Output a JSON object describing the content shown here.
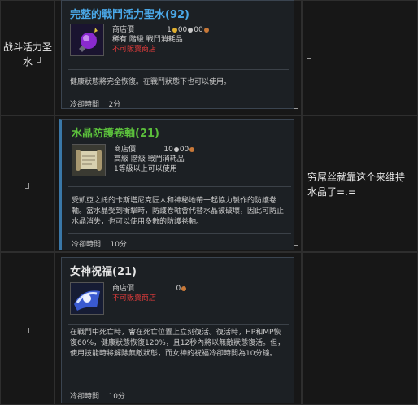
{
  "rows": [
    {
      "left": "战斗活力圣水",
      "right": "",
      "item": {
        "name": "完整的戰鬥活力聖水",
        "count": "(92)",
        "price_label": "商店價",
        "price_parts": [
          "1",
          "00",
          "00"
        ],
        "grade": "稀有 階級 戰鬥消耗品",
        "restriction": "不可販賣商店",
        "level_req": "",
        "description": "健康狀態將完全恢復。在戰鬥狀態下也可以使用。",
        "cooldown_label": "冷卻時間",
        "cooldown": "2分"
      }
    },
    {
      "left": "",
      "right": "穷屌丝就靠这个来维持水晶了=.=",
      "item": {
        "name": "水晶防護卷軸",
        "count": "(21)",
        "price_label": "商店價",
        "price_parts": [
          "10",
          "00",
          ""
        ],
        "grade": "高級 階級 戰鬥消耗品",
        "restriction": "",
        "level_req": "1等級以上可以使用",
        "description": "受凱亞之託的卡斯塔尼克匠人和神秘地帶一起協力製作的防護卷軸。當水晶受到衝擊時，防護卷軸會代替水晶被破壞，因此可防止水晶消失，也可以使用多數的防護卷軸。",
        "cooldown_label": "冷卻時間",
        "cooldown": "10分"
      }
    },
    {
      "left": "",
      "right": "",
      "item": {
        "name": "女神祝福",
        "count": "(21)",
        "price_label": "商店價",
        "price_parts": [
          "0",
          "",
          ""
        ],
        "grade": "",
        "restriction": "不可販賣商店",
        "level_req": "",
        "description": "在戰鬥中死亡時，會在死亡位置上立刻復活。復活時，HP和MP恢復60%，健康狀態恢復120%，且12秒內將以無敵狀態復活。但，使用技能時將解除無敵狀態，而女神的祝福冷卻時間為10分鐘。",
        "cooldown_label": "冷卻時間",
        "cooldown": "10分"
      }
    }
  ],
  "colors": {
    "rare_title": "#4aa8e8",
    "superior_title": "#5bbf3c",
    "common_title": "#e6e6e6",
    "restriction": "#e03b3b",
    "gold_coin": "#e0b030",
    "silver_coin": "#c8c8c8",
    "copper_coin": "#c87838"
  },
  "icons": [
    "purple-potion-icon",
    "scroll-icon",
    "blessing-scroll-icon",
    "coin-icon"
  ]
}
